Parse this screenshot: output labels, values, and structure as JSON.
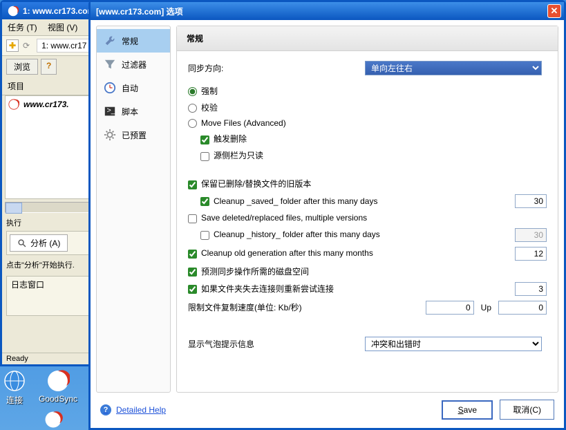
{
  "bg": {
    "title": "1: www.cr173.com",
    "menu": {
      "tasks": "任务 (T)",
      "view": "视图 (V)"
    },
    "tab": "1: www.cr17",
    "browse": "浏览",
    "help_q": "?",
    "projects_label": "项目",
    "list_item": "www.cr173.",
    "exec_label": "执行",
    "analyze": "分析 (A)",
    "hint": "点击\"分析\"开始执行.",
    "log_label": "日志窗口",
    "status": "Ready"
  },
  "desktop": {
    "connect": "连接",
    "goodsync": "GoodSync"
  },
  "dialog": {
    "title": "[www.cr173.com] 选项",
    "sidebar": {
      "general": "常规",
      "filter": "过滤器",
      "auto": "自动",
      "script": "脚本",
      "preset": "已预置"
    },
    "header": "常规",
    "direction_label": "同步方向:",
    "direction_value": "单向左往右",
    "radio_force": "强制",
    "radio_verify": "校验",
    "radio_move": "Move Files (Advanced)",
    "cb_trigger_delete": "触发删除",
    "cb_src_readonly": "源侧栏为只读",
    "cb_keep_old": "保留已删除/替换文件的旧版本",
    "cb_cleanup_saved": "Cleanup _saved_ folder after this many days",
    "val_cleanup_saved": "30",
    "cb_save_multi": "Save deleted/replaced files, multiple versions",
    "cb_cleanup_history": "Cleanup _history_ folder after this many days",
    "val_cleanup_history": "30",
    "cb_cleanup_gen": "Cleanup old generation after this many months",
    "val_cleanup_gen": "12",
    "cb_predict_disk": "预测同步操作所需的磁盘空间",
    "cb_retry_lost": "如果文件夹失去连接则重新尝试连接",
    "val_retry": "3",
    "limit_label": "限制文件复制速度(单位: Kb/秒)",
    "val_limit_dn": "0",
    "up_label": "Up",
    "val_limit_up": "0",
    "balloon_label": "显示气泡提示信息",
    "balloon_value": "冲突和出错时",
    "help": "Detailed Help",
    "save": "Save",
    "cancel": "取消(C)"
  }
}
